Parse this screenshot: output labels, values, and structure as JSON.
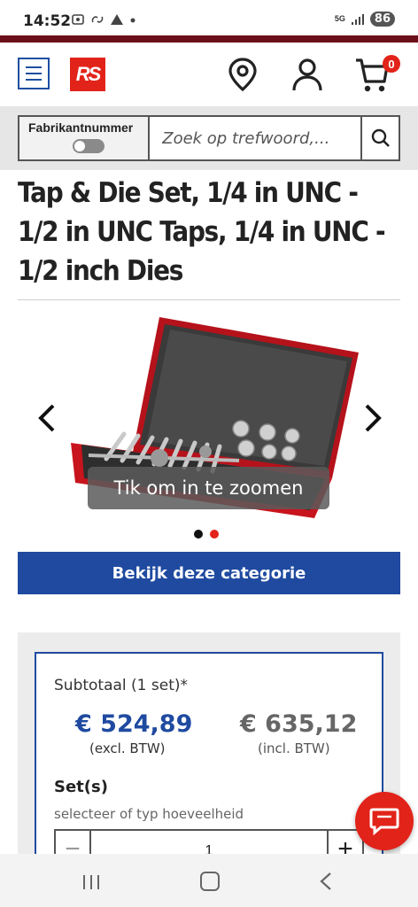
{
  "status_bar": {
    "time": "14:52",
    "network": "5G",
    "battery": "86"
  },
  "header": {
    "logo_text": "RS",
    "cart_count": "0",
    "icons": [
      "menu-icon",
      "location-pin-icon",
      "user-icon",
      "cart-icon"
    ],
    "accent_color": "#e2231a",
    "brand_blue": "#1f4aa0"
  },
  "search": {
    "toggle_label": "Fabrikantnummer",
    "toggle_state": "off",
    "placeholder": "Zoek op trefwoord,..."
  },
  "product": {
    "title": "Tap & Die Set, 1/4 in UNC - 1/2 in UNC Taps, 1/4 in UNC - 1/2 inch Dies",
    "zoom_hint": "Tik om in te zoomen",
    "gallery_dots": 2,
    "gallery_active_index": 1,
    "category_button": "Bekijk deze categorie"
  },
  "pricing": {
    "subtotal_label": "Subtotaal (1 set)*",
    "price_excl": "€ 524,89",
    "label_excl": "(excl. BTW)",
    "price_incl": "€ 635,12",
    "label_incl": "(incl. BTW)",
    "quantity_label": "Set(s)",
    "quantity_hint": "selecteer of typ hoeveelheid",
    "quantity_value": "1",
    "minus": "−",
    "plus": "+"
  }
}
